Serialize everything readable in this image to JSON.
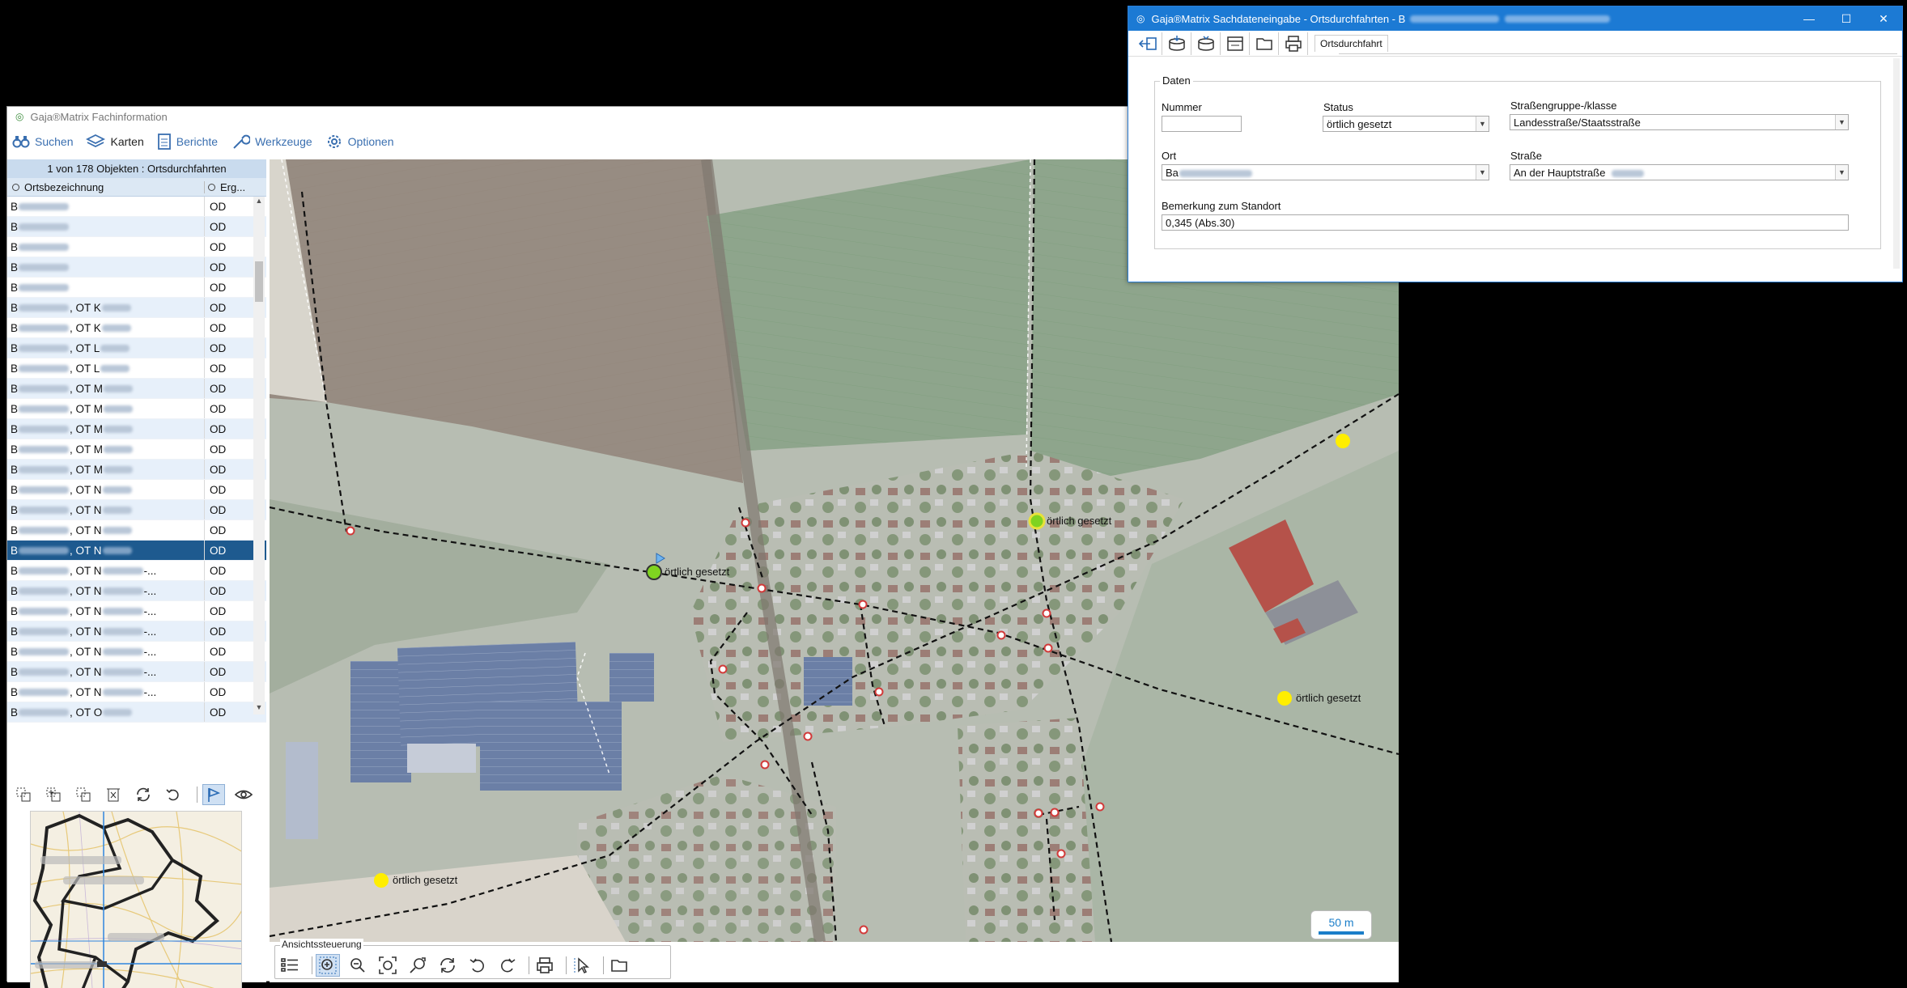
{
  "main_window": {
    "title": "Gaja®Matrix Fachinformation",
    "toolbar": [
      {
        "label": "Suchen",
        "icon": "binoculars-icon"
      },
      {
        "label": "Karten",
        "icon": "layers-icon"
      },
      {
        "label": "Berichte",
        "icon": "report-icon"
      },
      {
        "label": "Werkzeuge",
        "icon": "wrench-icon"
      },
      {
        "label": "Optionen",
        "icon": "gear-icon"
      }
    ]
  },
  "result_list": {
    "count_text": "1 von 178 Objekten : Ortsdurchfahrten",
    "col_name": "Ortsbezeichnung",
    "col_result": "Erg...",
    "rows": [
      {
        "prefix": "B",
        "suffix": "",
        "result": "OD"
      },
      {
        "prefix": "B",
        "suffix": "",
        "result": "OD"
      },
      {
        "prefix": "B",
        "suffix": "",
        "result": "OD"
      },
      {
        "prefix": "B",
        "suffix": "",
        "result": "OD"
      },
      {
        "prefix": "B",
        "suffix": "",
        "result": "OD"
      },
      {
        "prefix": "B",
        "suffix": ", OT K",
        "result": "OD"
      },
      {
        "prefix": "B",
        "suffix": ", OT K",
        "result": "OD"
      },
      {
        "prefix": "B",
        "suffix": ", OT L",
        "result": "OD"
      },
      {
        "prefix": "B",
        "suffix": ", OT L",
        "result": "OD"
      },
      {
        "prefix": "B",
        "suffix": ", OT M",
        "result": "OD"
      },
      {
        "prefix": "B",
        "suffix": ", OT M",
        "result": "OD"
      },
      {
        "prefix": "B",
        "suffix": ", OT M",
        "result": "OD"
      },
      {
        "prefix": "B",
        "suffix": ", OT M",
        "result": "OD"
      },
      {
        "prefix": "B",
        "suffix": ", OT M",
        "result": "OD"
      },
      {
        "prefix": "B",
        "suffix": ", OT N",
        "result": "OD"
      },
      {
        "prefix": "B",
        "suffix": ", OT N",
        "result": "OD"
      },
      {
        "prefix": "B",
        "suffix": ", OT N",
        "result": "OD"
      },
      {
        "prefix": "B",
        "suffix": ", OT N",
        "result": "OD",
        "selected": true
      },
      {
        "prefix": "B",
        "suffix": ", OT N",
        "tail": "-...",
        "result": "OD"
      },
      {
        "prefix": "B",
        "suffix": ", OT N",
        "tail": "-...",
        "result": "OD"
      },
      {
        "prefix": "B",
        "suffix": ", OT N",
        "tail": "-...",
        "result": "OD"
      },
      {
        "prefix": "B",
        "suffix": ", OT N",
        "tail": "-...",
        "result": "OD"
      },
      {
        "prefix": "B",
        "suffix": ", OT N",
        "tail": "-...",
        "result": "OD"
      },
      {
        "prefix": "B",
        "suffix": ", OT N",
        "tail": "-...",
        "result": "OD"
      },
      {
        "prefix": "B",
        "suffix": ", OT N",
        "tail": "-...",
        "result": "OD"
      },
      {
        "prefix": "B",
        "suffix": ", OT O",
        "result": "OD"
      }
    ]
  },
  "map": {
    "point_labels": [
      "örtlich gesetzt",
      "örtlich gesetzt",
      "örtlich gesetzt",
      "örtlich gesetzt"
    ],
    "scale_label": "50 m",
    "colors": {
      "marker_yellow": "#ffee00",
      "marker_green": "#7fd320",
      "node_red": "#d23a3a"
    }
  },
  "view_control": {
    "label": "Ansichtssteuerung",
    "icons": [
      "legend-icon",
      "zoom-in-icon",
      "zoom-out-icon",
      "zoom-extent-icon",
      "zoom-to-selection-icon",
      "refresh-icon",
      "undo-icon",
      "redo-icon",
      "print-icon",
      "select-pointer-icon",
      "folder-icon"
    ]
  },
  "dialog": {
    "title_prefix": "Gaja®Matrix Sachdateneingabe - Ortsdurchfahrten - B",
    "tab": "Ortsdurchfahrt",
    "group": "Daten",
    "fields": {
      "nummer": {
        "label": "Nummer",
        "value": ""
      },
      "status": {
        "label": "Status",
        "value": "örtlich gesetzt"
      },
      "strassengruppe": {
        "label": "Straßengruppe-/klasse",
        "value": "Landesstraße/Staatsstraße"
      },
      "ort": {
        "label": "Ort",
        "value": "Ba"
      },
      "strasse": {
        "label": "Straße",
        "value": "An der Hauptstraße"
      },
      "bemerkung": {
        "label": "Bemerkung zum Standort",
        "value": "0,345 (Abs.30)"
      }
    }
  }
}
